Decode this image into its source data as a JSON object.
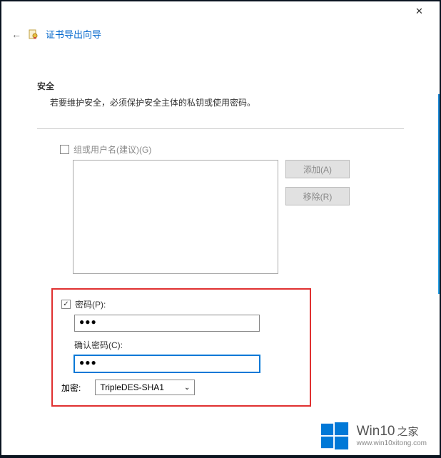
{
  "titlebar": {
    "close": "✕"
  },
  "header": {
    "back": "←",
    "title": "证书导出向导"
  },
  "security": {
    "heading": "安全",
    "desc": "若要维护安全，必须保护安全主体的私钥或使用密码。"
  },
  "group": {
    "label": "组或用户名(建议)(G)",
    "checked": false,
    "add_btn": "添加(A)",
    "remove_btn": "移除(R)"
  },
  "password": {
    "checked": true,
    "label": "密码(P):",
    "value": "●●●",
    "confirm_label": "确认密码(C):",
    "confirm_value": "●●●",
    "enc_label": "加密:",
    "enc_value": "TripleDES-SHA1"
  },
  "watermark": {
    "brand": "Win10",
    "suffix": "之家",
    "url": "www.win10xitong.com"
  }
}
